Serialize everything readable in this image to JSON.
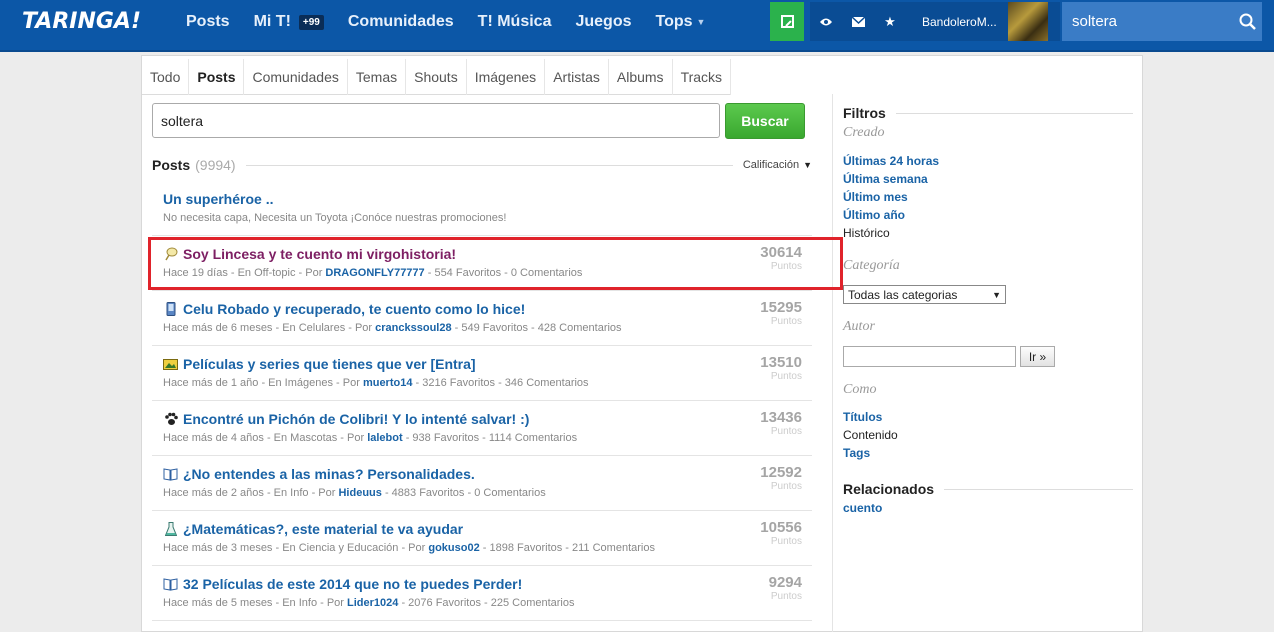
{
  "header": {
    "logo": "TARINGA!",
    "nav": [
      {
        "label": "Posts"
      },
      {
        "label": "Mi T!",
        "badge": "+99"
      },
      {
        "label": "Comunidades"
      },
      {
        "label": "T! Música"
      },
      {
        "label": "Juegos"
      },
      {
        "label": "Tops"
      }
    ],
    "username": "BandoleroM...",
    "search_value": "soltera"
  },
  "tabs": [
    "Todo",
    "Posts",
    "Comunidades",
    "Temas",
    "Shouts",
    "Imágenes",
    "Artistas",
    "Albums",
    "Tracks"
  ],
  "active_tab": "Posts",
  "search": {
    "value": "soltera",
    "button": "Buscar"
  },
  "results": {
    "title": "Posts",
    "count": "(9994)",
    "sort_label": "Calificación",
    "points_label": "Puntos",
    "posts": [
      {
        "title": "Un superhéroe ..",
        "meta_plain": "No necesita capa, Necesita un Toyota ¡Conóce nuestras promociones!",
        "icon": "",
        "points": ""
      },
      {
        "title": "Soy Lincesa y te cuento mi virgohistoria!",
        "meta_pre": "Hace 19 días - En Off-topic - Por ",
        "author": "DRAGONFLY77777",
        "meta_post": " - 554 Favoritos - 0 Comentarios",
        "icon": "offtopic-icon",
        "points": "30614"
      },
      {
        "title": "Celu Robado y recuperado, te cuento como lo hice!",
        "meta_pre": "Hace más de 6 meses - En Celulares - Por ",
        "author": "cranckssoul28",
        "meta_post": " - 549 Favoritos - 428 Comentarios",
        "icon": "phone-icon",
        "points": "15295"
      },
      {
        "title": "Películas y series que tienes que ver [Entra]",
        "meta_pre": "Hace más de 1 año - En Imágenes - Por ",
        "author": "muerto14",
        "meta_post": " - 3216 Favoritos - 346 Comentarios",
        "icon": "image-icon",
        "points": "13510"
      },
      {
        "title": "Encontré un Pichón de Colibri! Y lo intenté salvar! :)",
        "meta_pre": "Hace más de 4 años - En Mascotas - Por ",
        "author": "lalebot",
        "meta_post": " - 938 Favoritos - 1114 Comentarios",
        "icon": "paw-icon",
        "points": "13436"
      },
      {
        "title": "¿No entendes a las minas? Personalidades.",
        "meta_pre": "Hace más de 2 años - En Info - Por ",
        "author": "Hideuus",
        "meta_post": " - 4883 Favoritos - 0 Comentarios",
        "icon": "book-icon",
        "points": "12592"
      },
      {
        "title": "¿Matemáticas?, este material te va ayudar",
        "meta_pre": "Hace más de 3 meses - En Ciencia y Educación - Por ",
        "author": "gokuso02",
        "meta_post": " - 1898 Favoritos - 211 Comentarios",
        "icon": "flask-icon",
        "points": "10556"
      },
      {
        "title": "32 Películas de este 2014 que no te puedes Perder!",
        "meta_pre": "Hace más de 5 meses - En Info - Por ",
        "author": "Lider1024",
        "meta_post": " - 2076 Favoritos - 225 Comentarios",
        "icon": "book-icon",
        "points": "9294"
      }
    ]
  },
  "sidebar": {
    "filters_title": "Filtros",
    "created_label": "Creado",
    "created_options": [
      "Últimas 24 horas",
      "Última semana",
      "Último mes",
      "Último año",
      "Histórico"
    ],
    "category_label": "Categoría",
    "category_value": "Todas las categorias",
    "author_label": "Autor",
    "author_button": "Ir »",
    "como_label": "Como",
    "como_options": [
      "Títulos",
      "Contenido",
      "Tags"
    ],
    "related_title": "Relacionados",
    "related_items": [
      "cuento"
    ]
  },
  "colors": {
    "brand": "#0c57a7",
    "highlight_border": "#e0232b",
    "link": "#1a63a6",
    "search_button": "#3aa82f"
  }
}
